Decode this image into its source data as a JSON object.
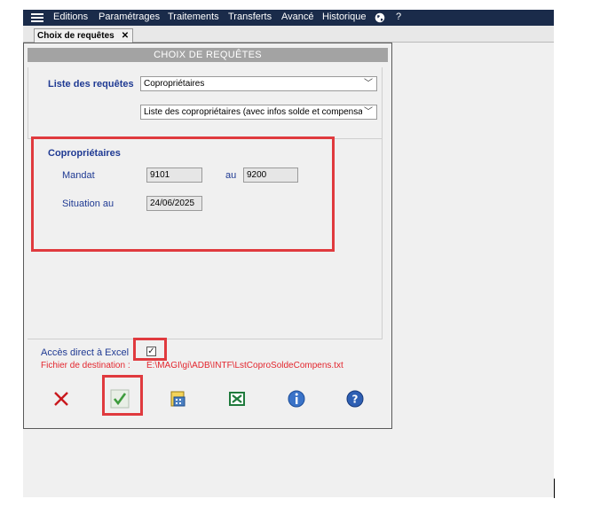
{
  "menubar": {
    "items": [
      "Editions",
      "Paramétrages",
      "Traitements",
      "Transferts",
      "Avancé",
      "Historique"
    ],
    "help": "?"
  },
  "tab": {
    "label": "Choix de requêtes",
    "close": "✕"
  },
  "window": {
    "title": "CHOIX DE REQUÊTES",
    "requests_label": "Liste des requêtes",
    "request_value": "Copropriétaires",
    "sub_request_value": "Liste des copropriétaires (avec infos solde et compensat",
    "section_title": "Copropriétaires",
    "mandat_label": "Mandat",
    "mandat_from": "9101",
    "au_label": "au",
    "mandat_to": "9200",
    "situation_label": "Situation au",
    "situation_value": "24/06/2025",
    "excel_label": "Accès direct à Excel",
    "excel_checked": true,
    "dest_label": "Fichier de destination :",
    "dest_value": "E:\\MAGI\\gi\\ADB\\INTF\\LstCoproSoldeCompens.txt"
  },
  "colors": {
    "menubar": "#1a2b4a",
    "highlight": "#e03a3e",
    "label_blue": "#1f3a93",
    "dest_red": "#e3262e"
  }
}
